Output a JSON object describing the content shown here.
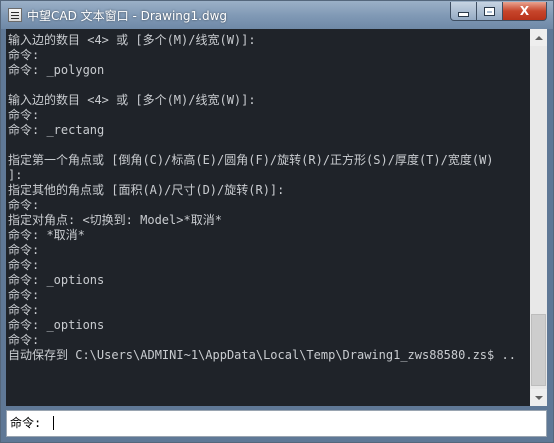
{
  "window": {
    "title": "中望CAD 文本窗口 - Drawing1.dwg",
    "controls": {
      "close_label": "X"
    }
  },
  "console": {
    "lines": [
      "输入边的数目 <4> 或 [多个(M)/线宽(W)]:",
      "命令:",
      "命令: _polygon",
      "",
      "输入边的数目 <4> 或 [多个(M)/线宽(W)]:",
      "命令:",
      "命令: _rectang",
      "",
      "指定第一个角点或 [倒角(C)/标高(E)/圆角(F)/旋转(R)/正方形(S)/厚度(T)/宽度(W)",
      "]:",
      "指定其他的角点或 [面积(A)/尺寸(D)/旋转(R)]:",
      "命令:",
      "指定对角点: <切换到: Model>*取消*",
      "命令: *取消*",
      "命令:",
      "命令:",
      "命令: _options",
      "命令:",
      "命令:",
      "命令: _options",
      "命令:",
      "自动保存到 C:\\Users\\ADMINI~1\\AppData\\Local\\Temp\\Drawing1_zws88580.zs$ .."
    ]
  },
  "prompt": {
    "label": "命令:",
    "value": ""
  },
  "colors": {
    "console_bg": "#1f2329",
    "console_text": "#c9ccd0",
    "prompt_bg": "#ffffff"
  }
}
